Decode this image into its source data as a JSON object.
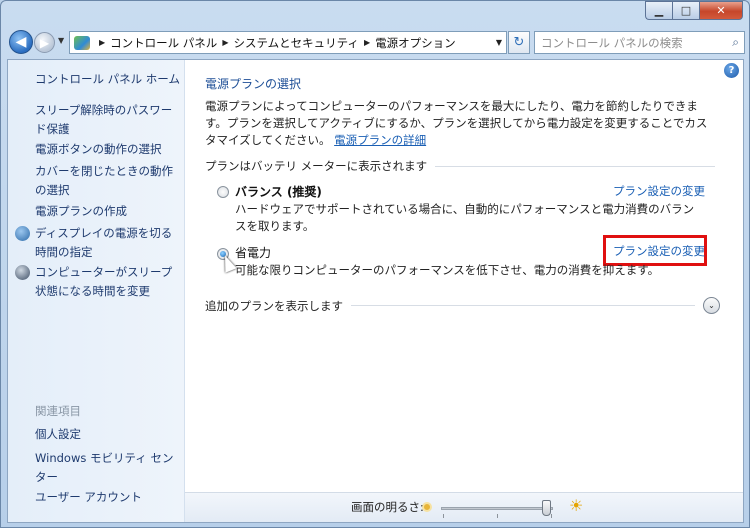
{
  "window": {
    "caption": {
      "min": "▁",
      "max": "□",
      "close": "✕"
    }
  },
  "navigation": {
    "back_glyph": "◀",
    "forward_glyph": "▶",
    "history_glyph": "▼",
    "breadcrumbs": [
      "コントロール パネル",
      "システムとセキュリティ",
      "電源オプション"
    ],
    "breadcrumb_sep": "▶",
    "dropdown_glyph": "▼",
    "refresh_glyph": "↻",
    "search_placeholder": "コントロール パネルの検索",
    "search_icon": "magnifier-icon"
  },
  "sidebar": {
    "home": "コントロール パネル ホーム",
    "links": [
      "スリープ解除時のパスワード保護",
      "電源ボタンの動作の選択",
      "カバーを閉じたときの動作の選択",
      "電源プランの作成",
      "ディスプレイの電源を切る時間の指定",
      "コンピューターがスリープ状態になる時間を変更"
    ],
    "related_heading": "関連項目",
    "related": [
      "個人設定",
      "Windows モビリティ センター",
      "ユーザー アカウント"
    ]
  },
  "main": {
    "help_glyph": "?",
    "title": "電源プランの選択",
    "description": "電源プランによってコンピューターのパフォーマンスを最大にしたり、電力を節約したりできます。プランを選択してアクティブにするか、プランを選択してから電力設定を変更することでカスタマイズしてください。",
    "description_link": "電源プランの詳細",
    "section_label": "プランはバッテリ メーターに表示されます",
    "plans": [
      {
        "name": "バランス (推奨)",
        "description": "ハードウェアでサポートされている場合に、自動的にパフォーマンスと電力消費のバランスを取ります。",
        "link": "プラン設定の変更",
        "selected": false
      },
      {
        "name": "省電力",
        "description": "可能な限りコンピューターのパフォーマンスを低下させ、電力の消費を抑えます。",
        "link": "プラン設定の変更",
        "selected": true
      }
    ],
    "more_plans": "追加のプランを表示します",
    "expand_glyph": "⌄"
  },
  "status": {
    "brightness_label": "画面の明るさ:",
    "brightness_level": 0.95,
    "bright_glyph": "☀"
  },
  "colors": {
    "highlight": "#e01010",
    "link": "#1a5fb4"
  }
}
